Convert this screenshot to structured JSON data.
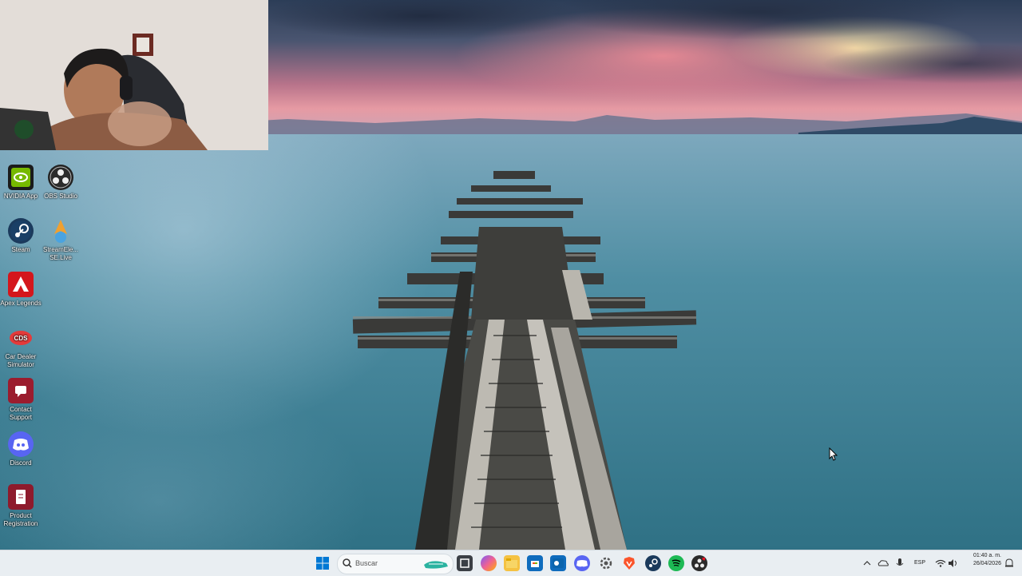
{
  "desktop": {
    "icons": [
      {
        "label": "NVIDIA App",
        "icon": "nvidia-icon"
      },
      {
        "label": "OBS Studio",
        "icon": "obs-icon"
      },
      {
        "label": "Steam",
        "icon": "steam-icon"
      },
      {
        "label": "StreamEle... SE.Live",
        "icon": "streamelements-icon"
      },
      {
        "label": "Apex Legends",
        "icon": "apex-icon"
      },
      {
        "label": "Car Dealer Simulator",
        "icon": "car-dealer-icon"
      },
      {
        "label": "Contact Support",
        "icon": "contact-support-icon"
      },
      {
        "label": "Discord",
        "icon": "discord-icon"
      },
      {
        "label": "Product Registration",
        "icon": "product-registration-icon"
      }
    ]
  },
  "taskbar": {
    "search_placeholder": "Buscar",
    "language": "ESP",
    "time": "01:40 a. m.",
    "date": "26/04/2026"
  },
  "colors": {
    "taskbar_bg": "#e9eef2",
    "windows_blue": "#0078d4"
  }
}
